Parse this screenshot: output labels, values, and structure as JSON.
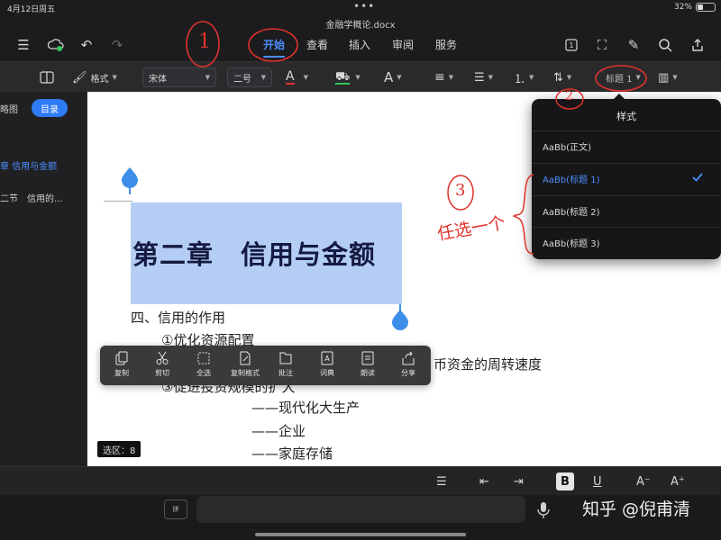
{
  "status": {
    "time": "4月12日周五",
    "battery": "32%"
  },
  "doc_title": "金融学概论.docx",
  "menu": {
    "tabs": [
      "开始",
      "查看",
      "插入",
      "审阅",
      "服务"
    ],
    "active_tab": "开始"
  },
  "format_toolbar": {
    "style_label": "格式",
    "font": "宋体",
    "size": "二号",
    "heading_style": "标题 1"
  },
  "sidebar": {
    "tab_outline": "略图",
    "tab_toc": "目录",
    "items": [
      "章 信用与金额",
      "二节　信用的..."
    ]
  },
  "document": {
    "heading": "第二章　信用与金额",
    "lines": [
      "四、信用的作用",
      "①优化资源配置",
      "币资金的周转速度",
      "③促进投资规模的扩大",
      "——现代化大生产",
      "——企业",
      "——家庭存储"
    ]
  },
  "selection_badge": "选区：8",
  "context_menu": [
    "复制",
    "剪切",
    "全选",
    "复制格式",
    "批注",
    "词典",
    "朗读",
    "分享"
  ],
  "styles_popover": {
    "title": "样式",
    "items": [
      "AaBb(正文)",
      "AaBb(标题 1)",
      "AaBb(标题 2)",
      "AaBb(标题 3)"
    ],
    "selected": "AaBb(标题 1)"
  },
  "annotations": {
    "mark1": "1",
    "mark2": "2",
    "mark3": "3",
    "note": "任选一个"
  },
  "keyboard_bar": {
    "key": "拼"
  },
  "watermark": "知乎 @倪甫清",
  "colors": {
    "accent": "#4c8dff",
    "annotation": "#e0322b",
    "highlight": "#b3cdf5"
  }
}
